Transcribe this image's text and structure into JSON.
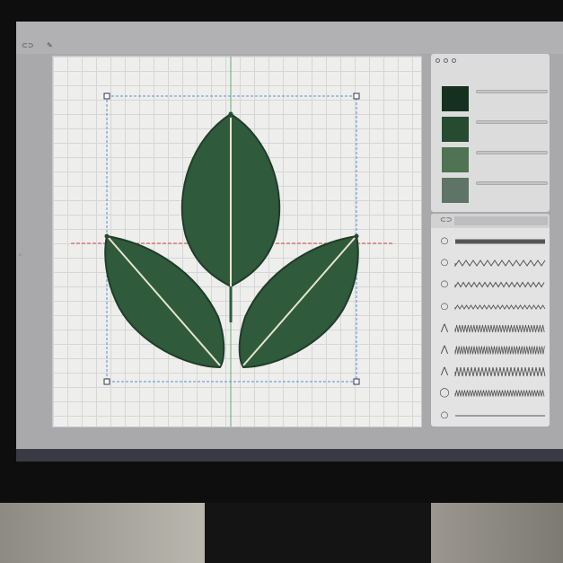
{
  "toolbar": {
    "icons": [
      "link-icon",
      "pen-tool-icon"
    ]
  },
  "design": {
    "thread_color": "#2f5a3c",
    "stitch_highlight": "#e8e4cc",
    "guide_color_blue": "#5a8fd0",
    "guide_color_red": "#d24a3a",
    "guide_color_green": "#4a9a4a"
  },
  "palette": {
    "swatches": [
      {
        "color": "#16301f"
      },
      {
        "color": "#264b30"
      },
      {
        "color": "#4f7353"
      },
      {
        "color": "#5e7466"
      }
    ]
  },
  "stitches": {
    "header_icon": "link-icon",
    "rows": [
      {
        "icon": "circle-icon",
        "type": "straight"
      },
      {
        "icon": "circle-icon",
        "type": "zigzag-small"
      },
      {
        "icon": "circle-icon",
        "type": "zigzag-tight"
      },
      {
        "icon": "circle-icon",
        "type": "zigzag-fine"
      },
      {
        "icon": "compass-icon",
        "type": "satin"
      },
      {
        "icon": "compass-icon",
        "type": "satin-dense"
      },
      {
        "icon": "compass-icon",
        "type": "zigzag-wide"
      },
      {
        "icon": "bulb-icon",
        "type": "satin-fine"
      },
      {
        "icon": "circle-icon",
        "type": "running"
      }
    ]
  }
}
